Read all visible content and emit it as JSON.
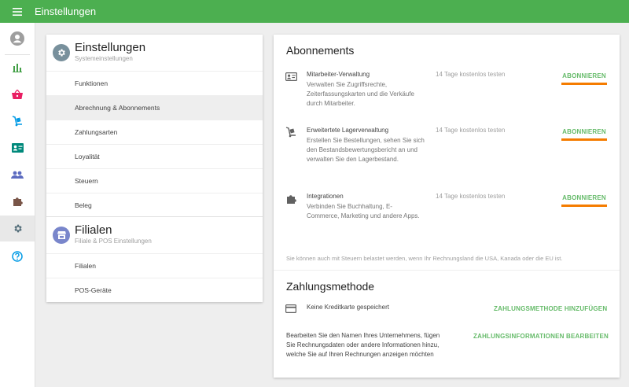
{
  "app": {
    "title": "Einstellungen"
  },
  "settings": {
    "section_title": "Einstellungen",
    "section_subtitle": "Systemeinstellungen",
    "items": [
      {
        "label": "Funktionen"
      },
      {
        "label": "Abrechnung & Abonnements",
        "selected": true
      },
      {
        "label": "Zahlungsarten"
      },
      {
        "label": "Loyalität"
      },
      {
        "label": "Steuern"
      },
      {
        "label": "Beleg"
      }
    ]
  },
  "branches": {
    "section_title": "Filialen",
    "section_subtitle": "Filiale & POS Einstellungen",
    "items": [
      {
        "label": "Filialen"
      },
      {
        "label": "POS-Geräte"
      }
    ]
  },
  "subscriptions": {
    "heading": "Abonnements",
    "items": [
      {
        "icon": "employee-card-icon",
        "name": "Mitarbeiter-Verwaltung",
        "description": "Verwalten Sie Zugriffsrechte, Zeiterfassungskarten und die Verkäufe durch Mitarbeiter.",
        "trial": "14 Tage kostenlos testen",
        "button": "ABONNIEREN"
      },
      {
        "icon": "hand-truck-icon",
        "name": "Erweitertete Lagerverwaltung",
        "description": "Erstellen Sie Bestellungen, sehen Sie sich den Bestandsbewertungsbericht an und verwalten Sie den Lagerbestand.",
        "trial": "14 Tage kostenlos testen",
        "button": "ABONNIEREN"
      },
      {
        "icon": "puzzle-icon",
        "name": "Integrationen",
        "description": "Verbinden Sie Buchhaltung, E-Commerce, Marketing und andere Apps.",
        "trial": "14 Tage kostenlos testen",
        "button": "ABONNIEREN"
      }
    ],
    "tax_note": "Sie können auch mit Steuern belastet werden, wenn Ihr Rechnungsland die USA, Kanada oder die EU ist."
  },
  "payment": {
    "heading": "Zahlungsmethode",
    "no_card": "Keine Kreditkarte gespeichert",
    "add_button": "ZAHLUNGSMETHODE HINZUFÜGEN",
    "billing_text": "Bearbeiten Sie den Namen Ihres Unternehmens, fügen Sie Rechnungsdaten oder andere Informationen hinzu, welche Sie auf Ihren Rechnungen anzeigen möchten",
    "edit_button": "ZAHLUNGSINFORMATIONEN BEARBEITEN"
  },
  "colors": {
    "topbar": "#4caf50",
    "accent_green": "#66bb6a",
    "underline_orange": "#f57c00"
  }
}
